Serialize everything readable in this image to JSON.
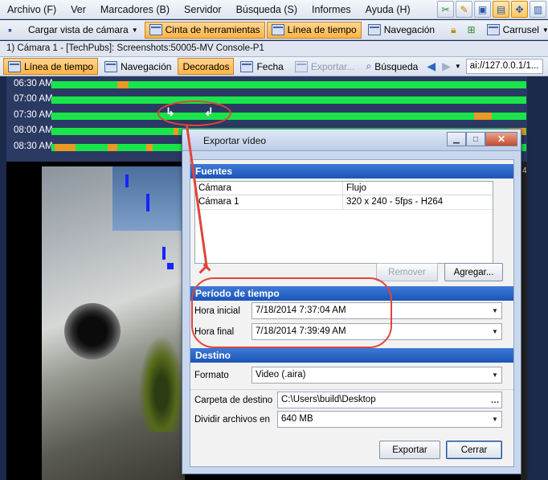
{
  "menubar": {
    "items": [
      "Archivo (F)",
      "Ver",
      "Marcadores (B)",
      "Servidor",
      "Búsqueda (S)",
      "Informes",
      "Ayuda (H)"
    ],
    "icons": [
      "cut-icon",
      "edit-icon",
      "monitor-icon",
      "layout-icon",
      "move-icon",
      "panel-icon"
    ]
  },
  "toolbar1": {
    "load_view": "Cargar vista de cámara",
    "tape_tools": "Cinta de herramientas",
    "timeline": "Línea de tiempo",
    "navigation": "Navegación",
    "carousel": "Carrusel"
  },
  "camera_title": "1) Cámara 1 - [TechPubs]: Screenshots:50005-MV Console-P1",
  "toolbar2": {
    "timeline": "Línea de tiempo",
    "navigation": "Navegación",
    "decorated": "Decorados",
    "date": "Fecha",
    "export": "Exportar...",
    "search": "Búsqueda",
    "address": "ai://127.0.0.1/1..."
  },
  "timeline": {
    "rows": [
      {
        "label": "06:30 AM"
      },
      {
        "label": "07:00 AM"
      },
      {
        "label": "07:30 AM"
      },
      {
        "label": "08:00 AM"
      },
      {
        "label": "08:30 AM"
      }
    ]
  },
  "video": {
    "corner_number": "4"
  },
  "dialog": {
    "title": "Exportar vídeo",
    "sources": {
      "heading": "Fuentes",
      "columns": [
        "Cámara",
        "Flujo"
      ],
      "rows": [
        [
          "Cámara 1",
          "320 x 240 - 5fps - H264"
        ]
      ],
      "remove_label": "Remover",
      "add_label": "Agregar..."
    },
    "period": {
      "heading": "Período de tiempo",
      "start_label": "Hora inicial",
      "start_value": "7/18/2014 7:37:04 AM",
      "end_label": "Hora final",
      "end_value": "7/18/2014 7:39:49 AM"
    },
    "destination": {
      "heading": "Destino",
      "format_label": "Formato",
      "format_value": "Video (.aira)",
      "folder_label": "Carpeta de destino",
      "folder_value": "C:\\Users\\build\\Desktop",
      "split_label": "Dividir archivos en",
      "split_value": "640 MB"
    },
    "export_label": "Exportar",
    "close_label": "Cerrar"
  },
  "colors": {
    "accent_orange": "#ffb441",
    "timeline_green": "#19e54a",
    "timeline_orange": "#e99a22",
    "section_blue": "#1c55b8",
    "annotation_red": "#e0443a"
  }
}
